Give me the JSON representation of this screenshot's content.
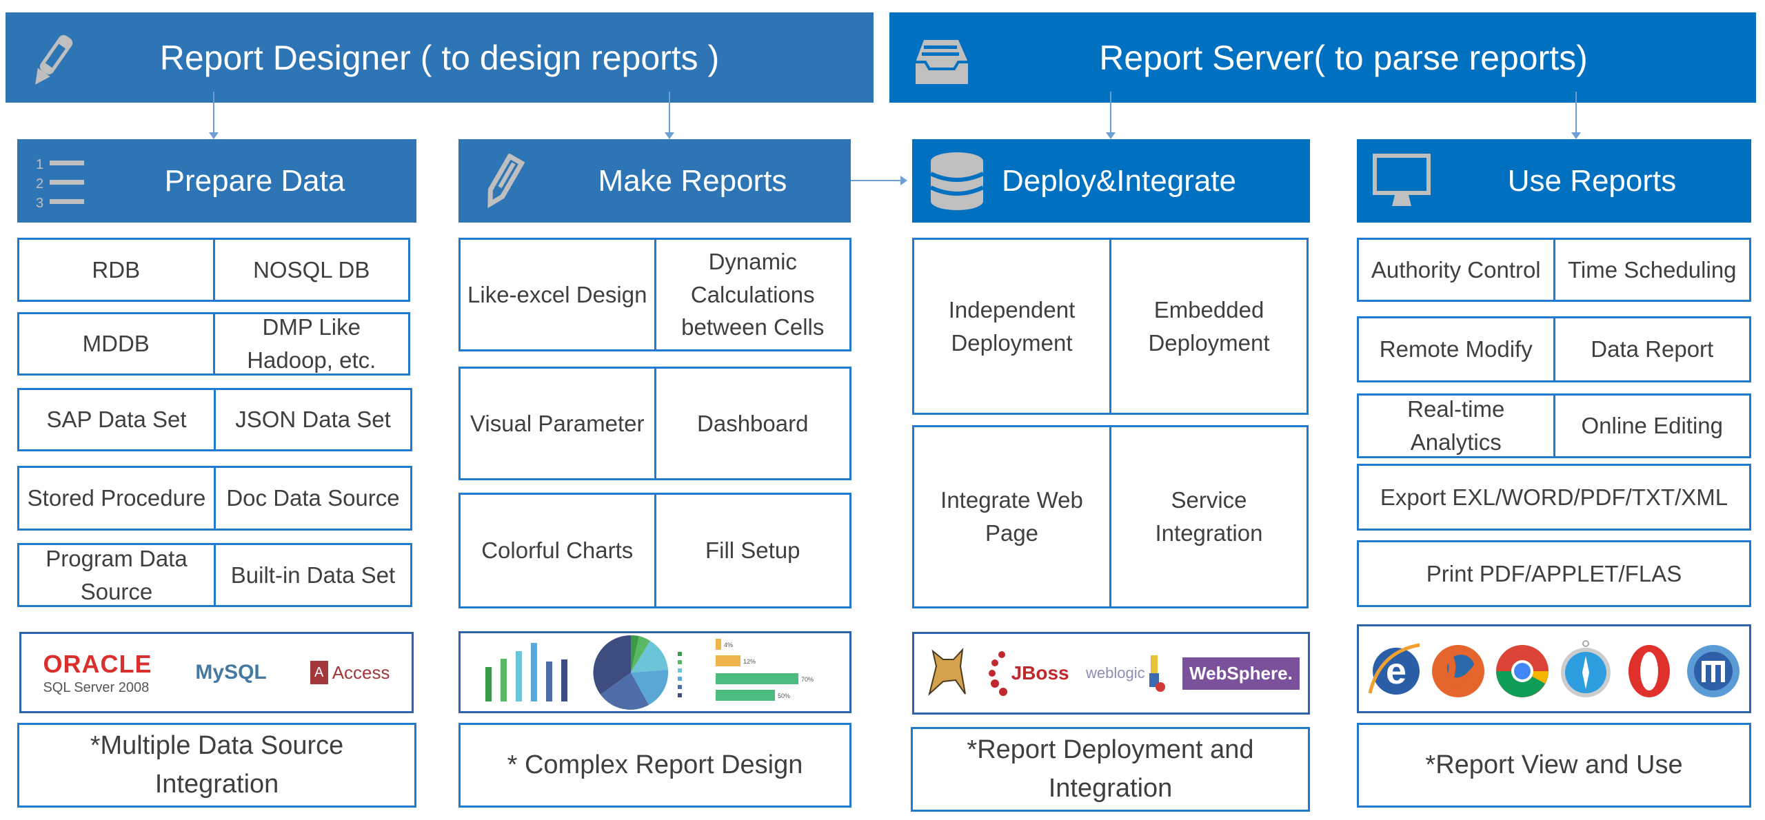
{
  "banners": {
    "designer": {
      "title": "Report Designer ( to design reports )",
      "icon": "pencil-icon"
    },
    "server": {
      "title": "Report Server( to parse reports)",
      "icon": "inbox-tray-icon"
    }
  },
  "colors": {
    "designer_blue": "#2e75b6",
    "server_blue": "#0070c0",
    "border_blue": "#1f7ad0",
    "text_gray": "#3f3f3f",
    "icon_gray": "#bfbfbf"
  },
  "columns": {
    "prepare_data": {
      "title": "Prepare Data",
      "icon": "numbered-list-icon",
      "rows": [
        [
          "RDB",
          "NOSQL DB"
        ],
        [
          "MDDB",
          "DMP Like Hadoop, etc."
        ],
        [
          "SAP Data Set",
          "JSON Data Set"
        ],
        [
          "Stored Procedure",
          "Doc Data Source"
        ],
        [
          "Program Data Source",
          "Built-in Data Set"
        ]
      ],
      "logos": [
        "ORACLE",
        "SQL Server 2008",
        "MySQL",
        "Access"
      ],
      "caption": "*Multiple Data Source Integration"
    },
    "make_reports": {
      "title": "Make Reports",
      "icon": "pen-edit-icon",
      "rows": [
        [
          "Like-excel Design",
          "Dynamic Calculations between Cells"
        ],
        [
          "Visual Parameter",
          "Dashboard"
        ],
        [
          "Colorful Charts",
          "Fill Setup"
        ]
      ],
      "thumbnail_labels": [
        "4%",
        "12%",
        "70%",
        "50%"
      ],
      "caption": "* Complex Report Design"
    },
    "deploy_integrate": {
      "title": "Deploy&Integrate",
      "icon": "database-icon",
      "rows": [
        [
          "Independent Deployment",
          "Embedded Deployment"
        ],
        [
          "Integrate Web Page",
          "Service Integration"
        ]
      ],
      "logos": [
        "Tomcat",
        "JBoss",
        "weblogic",
        "WebSphere."
      ],
      "caption": "*Report Deployment and Integration"
    },
    "use_reports": {
      "title": "Use Reports",
      "icon": "monitor-icon",
      "rows": [
        [
          "Authority Control",
          "Time Scheduling"
        ],
        [
          "Remote Modify",
          "Data Report"
        ],
        [
          "Real-time Analytics",
          "Online Editing"
        ],
        [
          "Export EXL/WORD/PDF/TXT/XML"
        ],
        [
          "Print PDF/APPLET/FLAS"
        ]
      ],
      "browsers": [
        "Internet Explorer",
        "Firefox",
        "Chrome",
        "Safari",
        "Opera",
        "Maxthon"
      ],
      "caption": "*Report View and Use"
    }
  }
}
